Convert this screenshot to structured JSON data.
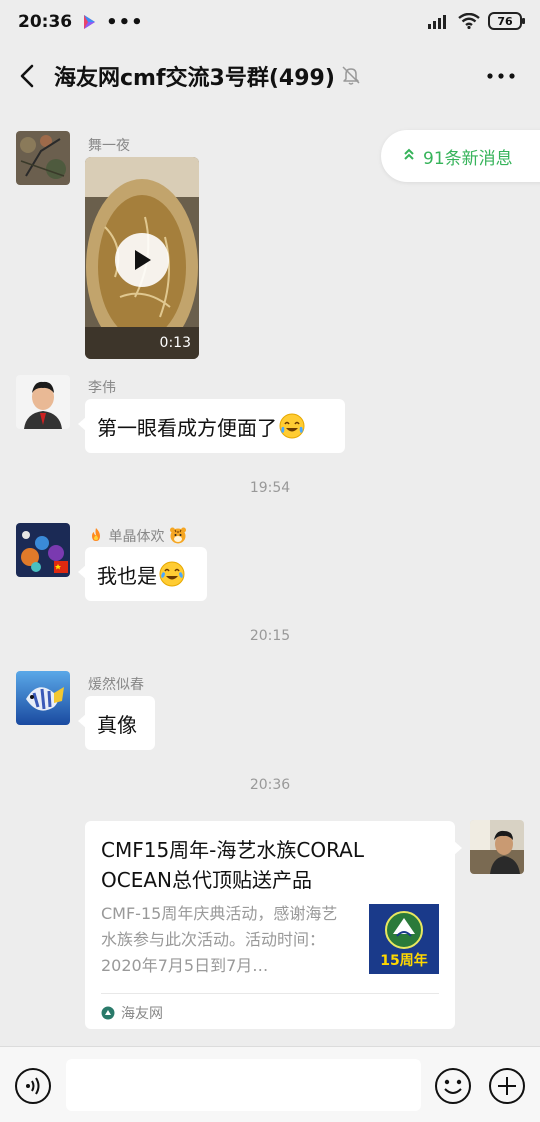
{
  "status_bar": {
    "time": "20:36",
    "dots": "•••",
    "battery": "76"
  },
  "header": {
    "title": "海友网cmf交流3号群(499)",
    "back_icon": "chevron-left-icon",
    "mute_icon": "bell-off-icon",
    "more_icon": "more-horizontal-icon"
  },
  "new_messages": {
    "label": "91条新消息"
  },
  "messages": [
    {
      "sender": "舞一夜",
      "type": "video",
      "duration": "0:13"
    },
    {
      "sender": "李伟",
      "text": "第一眼看成方便面了"
    },
    {
      "timestamp": "19:54"
    },
    {
      "sender": "单晶体欢",
      "text": "我也是"
    },
    {
      "timestamp": "20:15"
    },
    {
      "sender": "煖然似春",
      "text": "真像"
    },
    {
      "timestamp": "20:36"
    },
    {
      "type": "link",
      "title": "CMF15周年-海艺水族CORAL OCEAN总代顶贴送产品",
      "description": "CMF-15周年庆典活动，感谢海艺水族参与此次活动。活动时间：2020年7月5日到7月…",
      "thumb_label": "15周年",
      "source": "海友网"
    }
  ],
  "input_bar": {
    "placeholder": "",
    "voice_icon": "voice-icon",
    "emoji_icon": "smile-icon",
    "plus_icon": "plus-circle-icon"
  },
  "colors": {
    "background": "#ededed",
    "accent_green": "#36b35a",
    "bubble": "#ffffff"
  }
}
